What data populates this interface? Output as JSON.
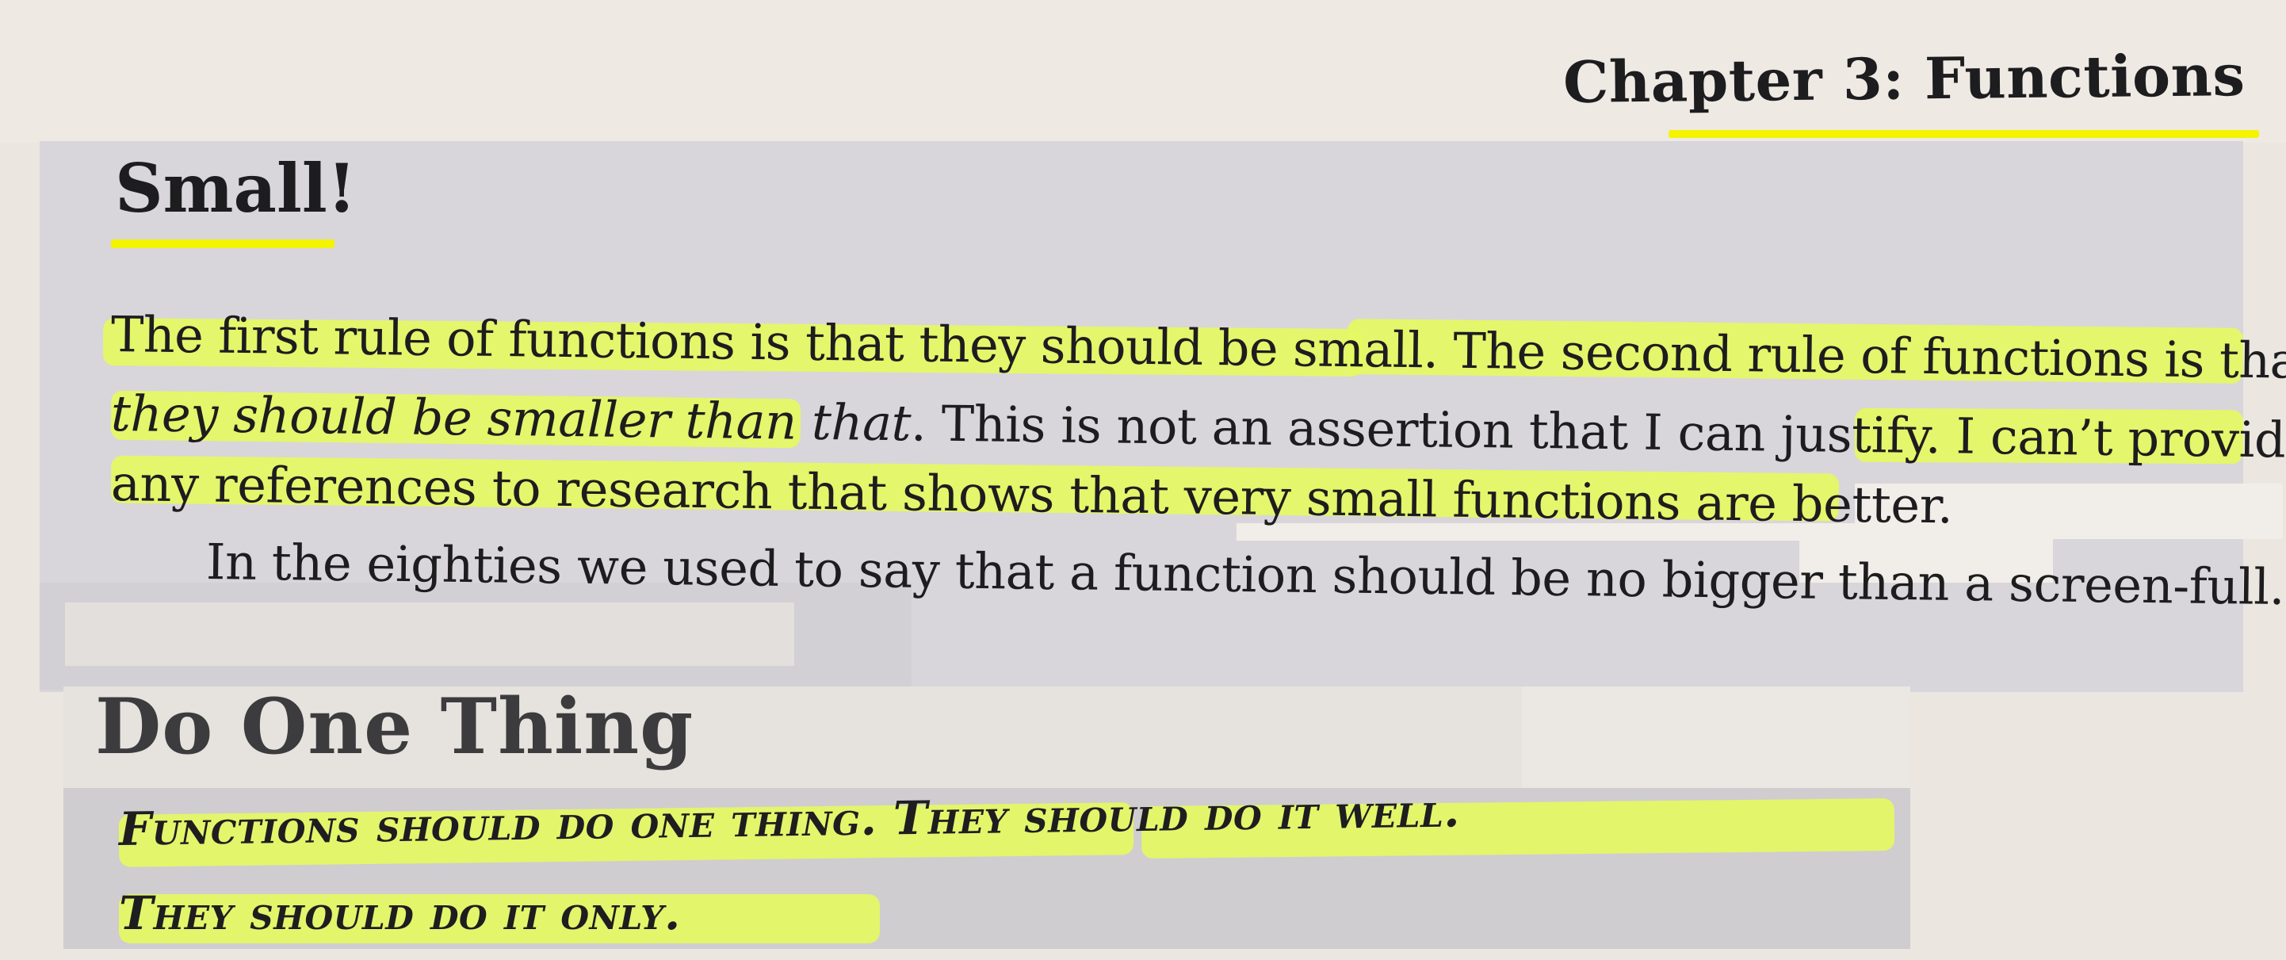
{
  "header": {
    "chapter_title": "Chapter 3: Functions"
  },
  "section_small": {
    "heading": "Small!",
    "line1": "The first rule of functions is that they should be small. The second rule of functions is that",
    "line2_italic": "they should be smaller than that",
    "line2_rest": ". This is not an assertion that I can justify. I can’t provide",
    "line3": "any references to research that shows that very small functions are better.",
    "line4": "In the eighties we used to say that a function should be no bigger than a screen-full."
  },
  "section_one_thing": {
    "heading": "Do One Thing",
    "rule_line1": "Functions should do one thing. They should do it well.",
    "rule_line2": "They should do it only."
  },
  "colors": {
    "highlighter": "#e5f862",
    "underline": "#f4f300",
    "paper": "#ece6e0",
    "panel": "#d8d6da"
  }
}
